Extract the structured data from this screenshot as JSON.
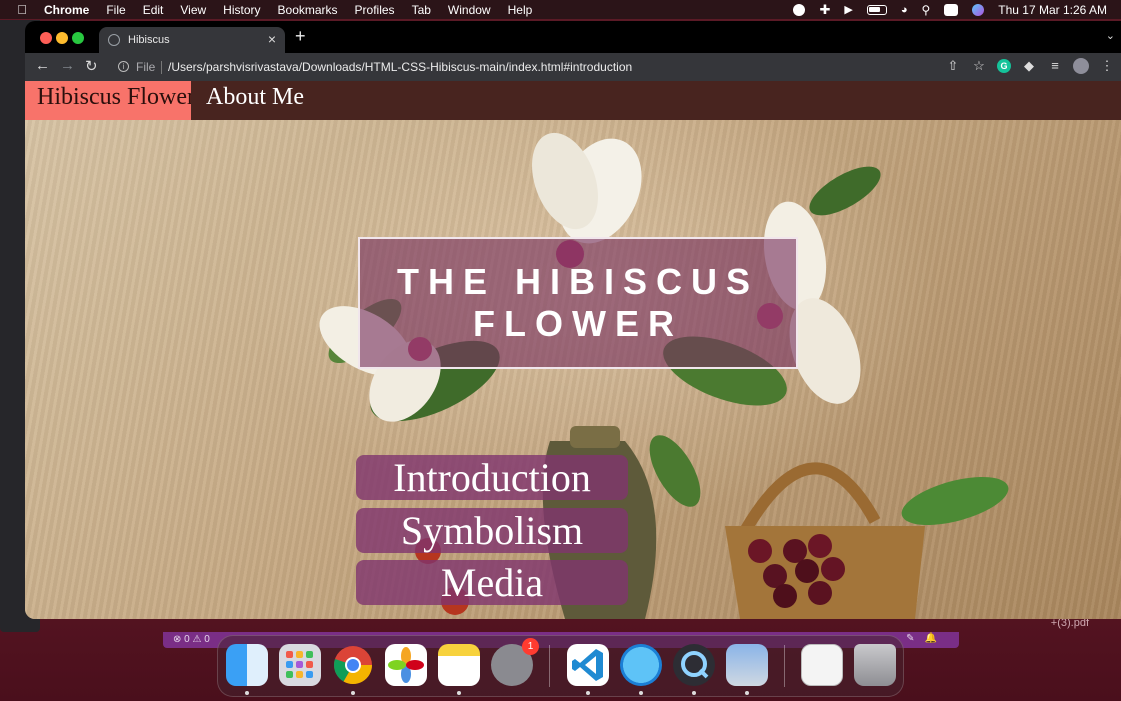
{
  "menubar": {
    "app_name": "Chrome",
    "items": [
      "File",
      "Edit",
      "View",
      "History",
      "Bookmarks",
      "Profiles",
      "Tab",
      "Window",
      "Help"
    ],
    "clock": "Thu 17 Mar  1:26 AM"
  },
  "browser": {
    "tab_title": "Hibiscus",
    "scheme_label": "File",
    "url": "/Users/parshvisrivastava/Downloads/HTML-CSS-Hibiscus-main/index.html#introduction",
    "extension_letter": "G"
  },
  "site": {
    "brand": "Hibiscus Flower",
    "nav_about": "About Me",
    "hero_line1": "THE HIBISCUS",
    "hero_line2": "FLOWER",
    "buttons": [
      "Introduction",
      "Symbolism",
      "Media"
    ]
  },
  "vscode": {
    "status_counts": "⊗ 0 ⚠ 0"
  },
  "desktop": {
    "pdf_label": "+(3).pdf"
  },
  "dock": {
    "apps": [
      "Finder",
      "Launchpad",
      "Chrome",
      "Photos",
      "Notes",
      "System Preferences",
      "Visual Studio Code",
      "Safari",
      "QuickTime Player",
      "Preview",
      "Document",
      "Trash"
    ],
    "settings_badge": "1"
  }
}
